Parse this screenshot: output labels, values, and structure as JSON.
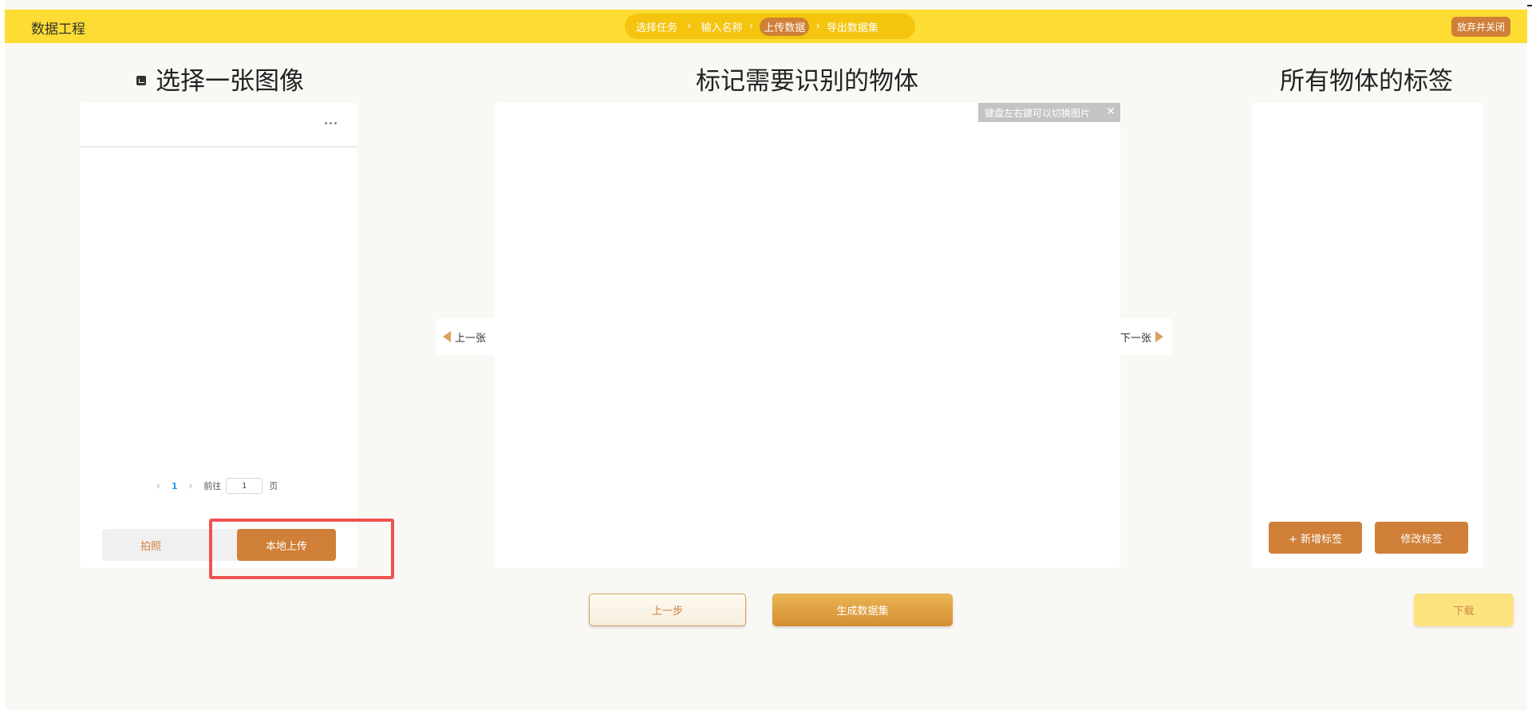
{
  "header": {
    "title": "数据工程",
    "steps": [
      "选择任务",
      "输入名称",
      "上传数据",
      "导出数据集"
    ],
    "abandon_label": "放弃并关闭"
  },
  "left": {
    "title": "选择一张图像",
    "pager": {
      "current_page": "1",
      "goto_label": "前往",
      "goto_value": "1",
      "unit_label": "页"
    },
    "photo_label": "拍照",
    "upload_label": "本地上传"
  },
  "center": {
    "title": "标记需要识别的物体",
    "hint": "键盘左右键可以切换图片",
    "prev_label": "上一张",
    "next_label": "下一张"
  },
  "right": {
    "title": "所有物体的标签",
    "add_label": "+ 新增标签",
    "edit_label": "修改标签"
  },
  "footer": {
    "prev_step_label": "上一步",
    "generate_label": "生成数据集",
    "download_label": "下载"
  },
  "colors": {
    "header_bg": "#fddc33",
    "accent": "#cf7f37",
    "highlight": "#f05252"
  }
}
